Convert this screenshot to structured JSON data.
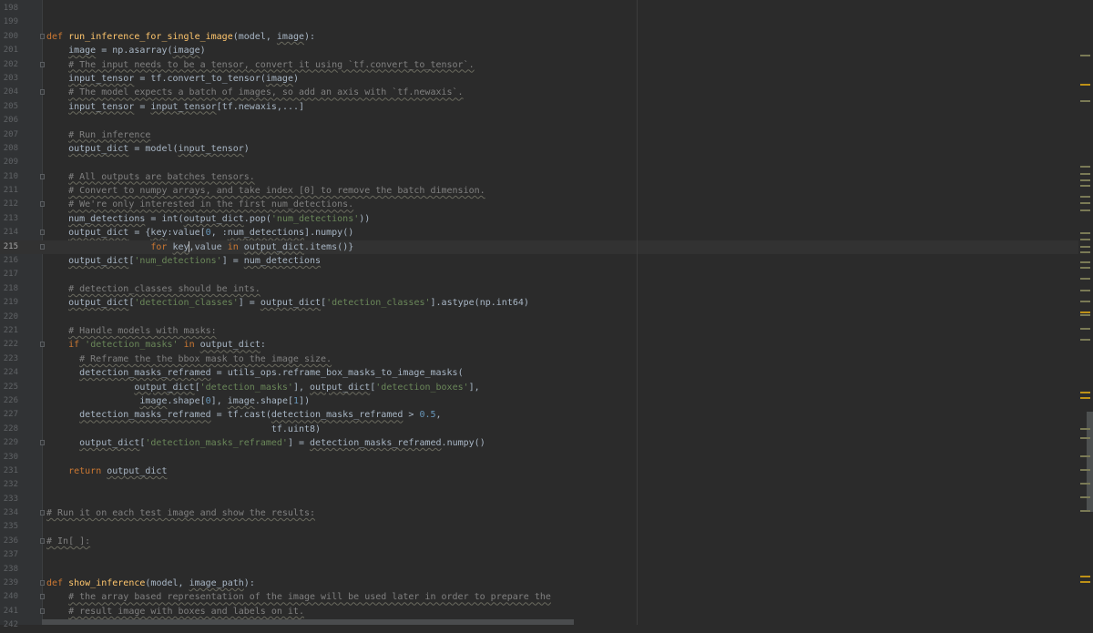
{
  "editor": {
    "current_line": "215",
    "lines": [
      {
        "n": "198",
        "t": ""
      },
      {
        "n": "199",
        "t": ""
      },
      {
        "n": "200",
        "t": "def run_inference_for_single_image(model, image):"
      },
      {
        "n": "201",
        "t": "    image = np.asarray(image)"
      },
      {
        "n": "202",
        "t": "    # The input needs to be a tensor, convert it using `tf.convert_to_tensor`."
      },
      {
        "n": "203",
        "t": "    input_tensor = tf.convert_to_tensor(image)"
      },
      {
        "n": "204",
        "t": "    # The model expects a batch of images, so add an axis with `tf.newaxis`."
      },
      {
        "n": "205",
        "t": "    input_tensor = input_tensor[tf.newaxis,...]"
      },
      {
        "n": "206",
        "t": ""
      },
      {
        "n": "207",
        "t": "    # Run inference"
      },
      {
        "n": "208",
        "t": "    output_dict = model(input_tensor)"
      },
      {
        "n": "209",
        "t": ""
      },
      {
        "n": "210",
        "t": "    # All outputs are batches tensors."
      },
      {
        "n": "211",
        "t": "    # Convert to numpy arrays, and take index [0] to remove the batch dimension."
      },
      {
        "n": "212",
        "t": "    # We're only interested in the first num_detections."
      },
      {
        "n": "213",
        "t": "    num_detections = int(output_dict.pop('num_detections'))"
      },
      {
        "n": "214",
        "t": "    output_dict = {key:value[0, :num_detections].numpy()"
      },
      {
        "n": "215",
        "t": "                   for key,value in output_dict.items()}"
      },
      {
        "n": "216",
        "t": "    output_dict['num_detections'] = num_detections"
      },
      {
        "n": "217",
        "t": ""
      },
      {
        "n": "218",
        "t": "    # detection_classes should be ints."
      },
      {
        "n": "219",
        "t": "    output_dict['detection_classes'] = output_dict['detection_classes'].astype(np.int64)"
      },
      {
        "n": "220",
        "t": ""
      },
      {
        "n": "221",
        "t": "    # Handle models with masks:"
      },
      {
        "n": "222",
        "t": "    if 'detection_masks' in output_dict:"
      },
      {
        "n": "223",
        "t": "      # Reframe the the bbox mask to the image size."
      },
      {
        "n": "224",
        "t": "      detection_masks_reframed = utils_ops.reframe_box_masks_to_image_masks("
      },
      {
        "n": "225",
        "t": "                output_dict['detection_masks'], output_dict['detection_boxes'],"
      },
      {
        "n": "226",
        "t": "                 image.shape[0], image.shape[1])"
      },
      {
        "n": "227",
        "t": "      detection_masks_reframed = tf.cast(detection_masks_reframed > 0.5,"
      },
      {
        "n": "228",
        "t": "                                         tf.uint8)"
      },
      {
        "n": "229",
        "t": "      output_dict['detection_masks_reframed'] = detection_masks_reframed.numpy()"
      },
      {
        "n": "230",
        "t": ""
      },
      {
        "n": "231",
        "t": "    return output_dict"
      },
      {
        "n": "232",
        "t": ""
      },
      {
        "n": "233",
        "t": ""
      },
      {
        "n": "234",
        "t": "# Run it on each test image and show the results:"
      },
      {
        "n": "235",
        "t": ""
      },
      {
        "n": "236",
        "t": "# In[ ]:"
      },
      {
        "n": "237",
        "t": ""
      },
      {
        "n": "238",
        "t": ""
      },
      {
        "n": "239",
        "t": "def show_inference(model, image_path):"
      },
      {
        "n": "240",
        "t": "    # the array based representation of the image will be used later in order to prepare the"
      },
      {
        "n": "241",
        "t": "    # result image with boxes and labels on it."
      },
      {
        "n": "242",
        "t": ""
      }
    ],
    "fold_lines": [
      "200",
      "202",
      "204",
      "210",
      "212",
      "214",
      "215",
      "222",
      "229",
      "234",
      "236",
      "239",
      "240",
      "241"
    ],
    "colors": {
      "background": "#2b2b2b",
      "keyword": "#cc7832",
      "function": "#ffc66d",
      "string": "#6a8759",
      "number": "#6897bb",
      "comment": "#808080",
      "text": "#a9b7c6"
    }
  }
}
